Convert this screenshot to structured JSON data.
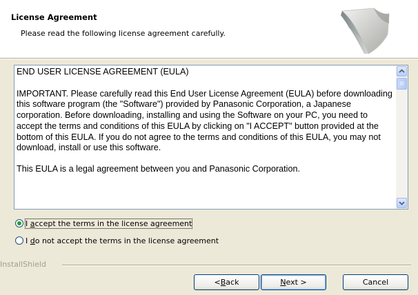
{
  "header": {
    "title": "License Agreement",
    "subtitle": "Please read the following license agreement carefully."
  },
  "license": {
    "paragraphs": [
      "END USER LICENSE AGREEMENT (EULA)",
      "IMPORTANT.  Please carefully read this End User License Agreement (EULA) before downloading this software program (the \"Software\") provided by Panasonic Corporation, a Japanese corporation.  Before downloading, installing and using the Software on your PC, you need to accept the terms and conditions of this EULA by clicking on \"I ACCEPT\" button provided at the bottom of this EULA.  If you do not agree to the terms and conditions of this EULA, you may not download, install or use this software.",
      "This EULA is a legal agreement between you and Panasonic Corporation."
    ]
  },
  "options": {
    "accept": {
      "prefix": "I ",
      "key": "a",
      "rest": "ccept the terms in the license agreement",
      "selected": true
    },
    "decline": {
      "prefix": "I ",
      "key": "d",
      "rest": "o not accept the terms in the license agreement",
      "selected": false
    }
  },
  "footer": {
    "brand": "InstallShield"
  },
  "buttons": {
    "back": {
      "prefix": "< ",
      "key": "B",
      "rest": "ack"
    },
    "next": {
      "prefix": "",
      "key": "N",
      "rest": "ext >"
    },
    "cancel": {
      "label": "Cancel"
    }
  },
  "colors": {
    "dialog_bg": "#ece9d8",
    "radio_selected": "#21a121",
    "scrollbar_blue": "#b8cdf8"
  },
  "icons": {
    "header_graphic": "installshield-wizard-graphic",
    "scroll_up": "arrow-up-icon",
    "scroll_down": "arrow-down-icon"
  }
}
